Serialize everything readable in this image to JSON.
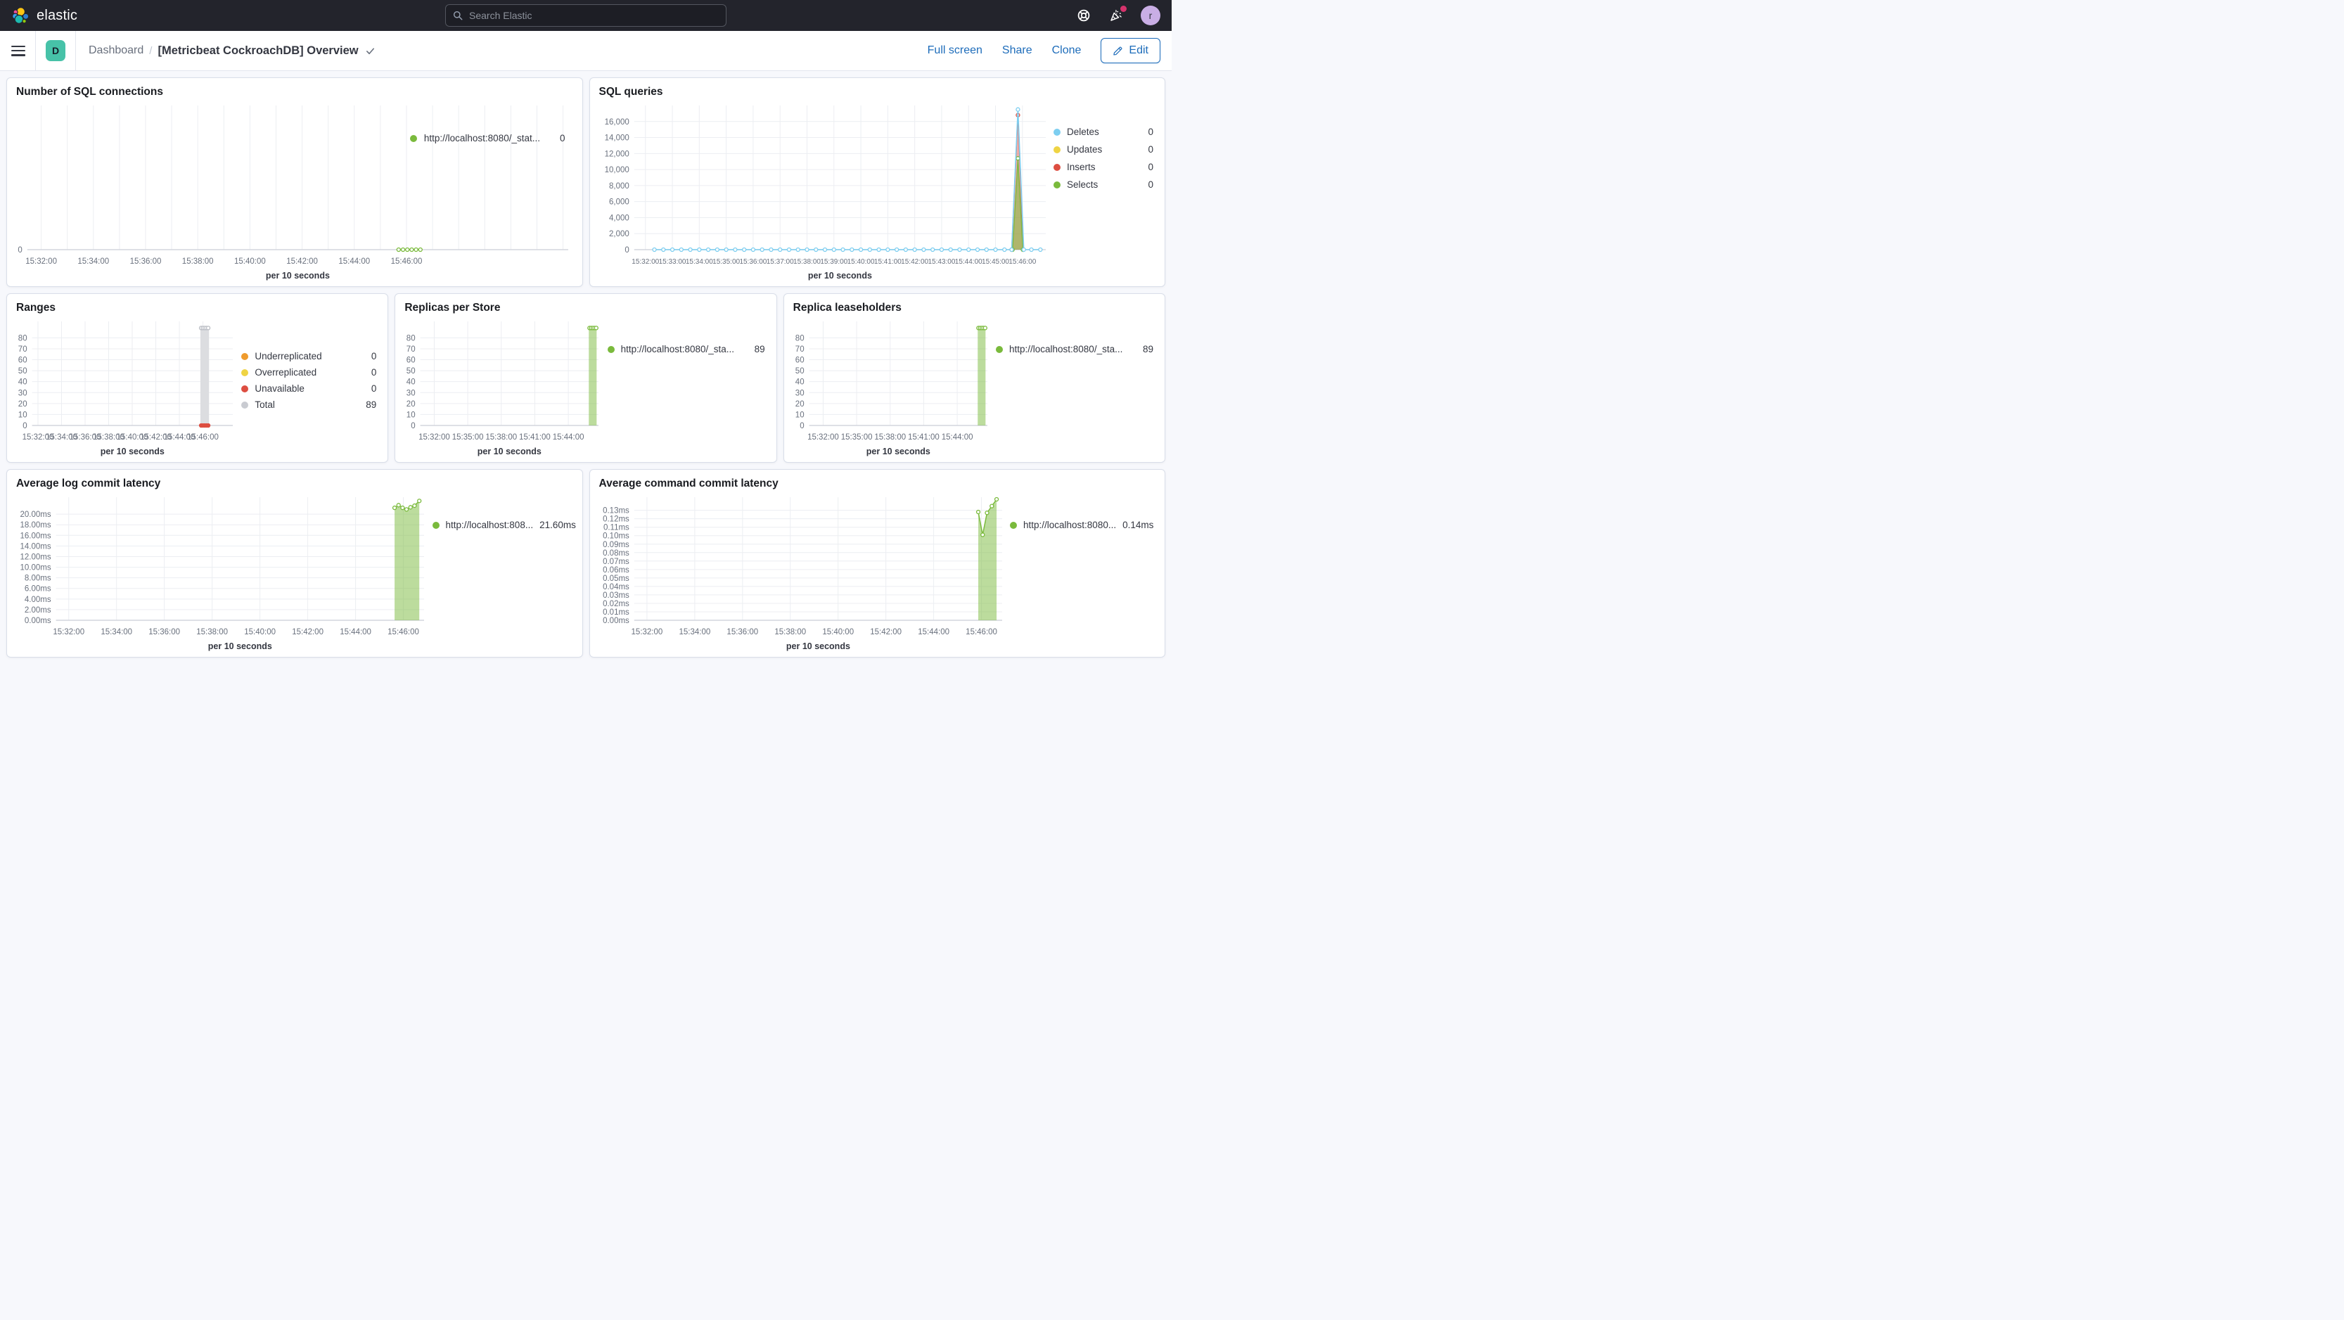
{
  "header": {
    "logo_text": "elastic",
    "search_placeholder": "Search Elastic",
    "help_icon": "help-lifering-icon",
    "news_icon": "party-popper-icon",
    "avatar_letter": "r",
    "colors": {
      "bar_bg": "#23242c",
      "notif_dot": "#d6336c",
      "avatar_bg": "#c9aee5"
    }
  },
  "nav": {
    "menu_icon": "hamburger-icon",
    "space_badge": "D",
    "breadcrumb_root": "Dashboard",
    "separator": "/",
    "title": "[Metricbeat CockroachDB] Overview",
    "title_check_icon": "check-icon",
    "actions": {
      "full_screen": "Full screen",
      "share": "Share",
      "clone": "Clone",
      "edit": "Edit"
    },
    "accent": "#1d6cba",
    "badge_color": "#47c2a8"
  },
  "series_colors": {
    "green": "#7aba3c",
    "blue": "#7dcef0",
    "yellow": "#efd444",
    "red": "#dd4e41",
    "orange": "#ef9b2d",
    "gray": "#c9cbd1"
  },
  "panels": [
    {
      "title": "Number of SQL connections",
      "xlabel": "per 10 seconds",
      "legend": [
        {
          "label": "http://localhost:8080/_stat...",
          "value": "0",
          "color": "#7aba3c"
        }
      ],
      "chart": {
        "x_domain": [
          88,
          1332
        ],
        "grid": [
          120,
          1320,
          60
        ],
        "x_ticks": [
          [
            120,
            "15:32:00"
          ],
          [
            240,
            "15:34:00"
          ],
          [
            360,
            "15:36:00"
          ],
          [
            480,
            "15:38:00"
          ],
          [
            600,
            "15:40:00"
          ],
          [
            720,
            "15:42:00"
          ],
          [
            840,
            "15:44:00"
          ],
          [
            960,
            "15:46:00"
          ]
        ],
        "y": {
          "min": 0,
          "scale_max": 1,
          "ticks": [
            0
          ],
          "labels": [
            "0"
          ]
        },
        "series": [
          {
            "name": "connections",
            "type": "line",
            "color": "#7aba3c",
            "width": 1.4,
            "markers": "hollow",
            "points": [
              [
                942,
                0
              ],
              [
                952,
                0
              ],
              [
                962,
                0
              ],
              [
                972,
                0
              ],
              [
                982,
                0
              ],
              [
                992,
                0
              ]
            ]
          }
        ]
      }
    },
    {
      "title": "SQL queries",
      "xlabel": "per 10 seconds",
      "legend": [
        {
          "label": "Deletes",
          "value": "0",
          "color": "#7dcef0"
        },
        {
          "label": "Updates",
          "value": "0",
          "color": "#efd444"
        },
        {
          "label": "Inserts",
          "value": "0",
          "color": "#dd4e41"
        },
        {
          "label": "Selects",
          "value": "0",
          "color": "#7aba3c"
        }
      ],
      "chart": {
        "tick_font": 10,
        "x_domain": [
          95,
          1012
        ],
        "grid": [
          120,
          960,
          60
        ],
        "x_ticks": [
          [
            120,
            "15:32:00"
          ],
          [
            180,
            "15:33:00"
          ],
          [
            240,
            "15:34:00"
          ],
          [
            300,
            "15:35:00"
          ],
          [
            360,
            "15:36:00"
          ],
          [
            420,
            "15:37:00"
          ],
          [
            480,
            "15:38:00"
          ],
          [
            540,
            "15:39:00"
          ],
          [
            600,
            "15:40:00"
          ],
          [
            660,
            "15:41:00"
          ],
          [
            720,
            "15:42:00"
          ],
          [
            780,
            "15:43:00"
          ],
          [
            840,
            "15:44:00"
          ],
          [
            900,
            "15:45:00"
          ],
          [
            960,
            "15:46:00"
          ]
        ],
        "y": {
          "min": 0,
          "scale_max": 18000,
          "ticks": [
            0,
            2000,
            4000,
            6000,
            8000,
            10000,
            12000,
            14000,
            16000
          ],
          "labels": [
            "0",
            "2,000",
            "4,000",
            "6,000",
            "8,000",
            "10,000",
            "12,000",
            "14,000",
            "16,000"
          ]
        },
        "series": [
          {
            "name": "Inserts",
            "type": "area",
            "color": "#dd4e41",
            "fill": "rgba(221,78,65,0.45)",
            "width": 1.3,
            "markers": "hollow",
            "points": [
              [
                936,
                0
              ],
              [
                950,
                16800
              ],
              [
                962,
                0
              ]
            ]
          },
          {
            "name": "Selects",
            "type": "area",
            "color": "#7aba3c",
            "fill": "rgba(122,186,60,0.55)",
            "width": 1.3,
            "markers": "hollow",
            "points": [
              [
                938,
                0
              ],
              [
                950,
                11400
              ],
              [
                961,
                0
              ]
            ]
          },
          {
            "name": "Deletes",
            "type": "line",
            "color": "#7dcef0",
            "width": 1.6,
            "markers": "hollow",
            "flat": [
              140,
              920,
              20,
              0
            ],
            "points": [
              [
                936,
                0
              ],
              [
                950,
                17500
              ],
              [
                963,
                0
              ],
              [
                980,
                0
              ],
              [
                1000,
                0
              ]
            ]
          }
        ]
      }
    },
    {
      "title": "Ranges",
      "xlabel": "per 10 seconds",
      "legend": [
        {
          "label": "Underreplicated",
          "value": "0",
          "color": "#ef9b2d"
        },
        {
          "label": "Overreplicated",
          "value": "0",
          "color": "#efd444"
        },
        {
          "label": "Unavailable",
          "value": "0",
          "color": "#dd4e41"
        },
        {
          "label": "Total",
          "value": "89",
          "color": "#c9cbd1"
        }
      ],
      "chart": {
        "x_domain": [
          90,
          1112
        ],
        "grid": [
          120,
          960,
          120
        ],
        "x_ticks": [
          [
            120,
            "15:32:00"
          ],
          [
            240,
            "15:34:00"
          ],
          [
            360,
            "15:36:00"
          ],
          [
            480,
            "15:38:00"
          ],
          [
            600,
            "15:40:00"
          ],
          [
            720,
            "15:42:00"
          ],
          [
            840,
            "15:44:00"
          ],
          [
            960,
            "15:46:00"
          ]
        ],
        "y": {
          "min": 0,
          "scale_max": 95,
          "ticks": [
            0,
            10,
            20,
            30,
            40,
            50,
            60,
            70,
            80
          ],
          "labels": [
            "0",
            "10",
            "20",
            "30",
            "40",
            "50",
            "60",
            "70",
            "80"
          ]
        },
        "series": [
          {
            "name": "Total",
            "type": "bar",
            "color": "#dcdde0",
            "bars": [
              [
                947,
                991,
                89
              ]
            ]
          },
          {
            "type": "markers",
            "style": "hollow",
            "color": "#b9bcc3",
            "points": [
              [
                951,
                89
              ],
              [
                960,
                89
              ],
              [
                969,
                89
              ],
              [
                978,
                89
              ],
              [
                987,
                89
              ]
            ]
          },
          {
            "name": "Unavailable",
            "type": "markers",
            "style": "solid",
            "color": "#dd4e41",
            "points": [
              [
                951,
                0
              ],
              [
                960,
                0
              ],
              [
                969,
                0
              ],
              [
                978,
                0
              ],
              [
                987,
                0
              ]
            ]
          }
        ]
      }
    },
    {
      "title": "Replicas per Store",
      "xlabel": "per 10 seconds",
      "legend": [
        {
          "label": "http://localhost:8080/_sta...",
          "value": "89",
          "color": "#7aba3c"
        }
      ],
      "chart": {
        "x_domain": [
          45,
          1002
        ],
        "grid": [
          120,
          960,
          180
        ],
        "x_ticks": [
          [
            120,
            "15:32:00"
          ],
          [
            300,
            "15:35:00"
          ],
          [
            480,
            "15:38:00"
          ],
          [
            660,
            "15:41:00"
          ],
          [
            840,
            "15:44:00"
          ]
        ],
        "y": {
          "min": 0,
          "scale_max": 95,
          "ticks": [
            0,
            10,
            20,
            30,
            40,
            50,
            60,
            70,
            80
          ],
          "labels": [
            "0",
            "10",
            "20",
            "30",
            "40",
            "50",
            "60",
            "70",
            "80"
          ]
        },
        "series": [
          {
            "name": "replicas",
            "type": "bar",
            "color": "rgba(122,186,60,0.5)",
            "bars": [
              [
                950,
                992,
                89
              ]
            ]
          },
          {
            "type": "markers",
            "style": "hollow",
            "color": "#7aba3c",
            "points": [
              [
                954,
                89
              ],
              [
                963,
                89
              ],
              [
                972,
                89
              ],
              [
                981,
                89
              ],
              [
                990,
                89
              ]
            ]
          }
        ]
      }
    },
    {
      "title": "Replica leaseholders",
      "xlabel": "per 10 seconds",
      "legend": [
        {
          "label": "http://localhost:8080/_sta...",
          "value": "89",
          "color": "#7aba3c"
        }
      ],
      "chart": {
        "x_domain": [
          45,
          1002
        ],
        "grid": [
          120,
          960,
          180
        ],
        "x_ticks": [
          [
            120,
            "15:32:00"
          ],
          [
            300,
            "15:35:00"
          ],
          [
            480,
            "15:38:00"
          ],
          [
            660,
            "15:41:00"
          ],
          [
            840,
            "15:44:00"
          ]
        ],
        "y": {
          "min": 0,
          "scale_max": 95,
          "ticks": [
            0,
            10,
            20,
            30,
            40,
            50,
            60,
            70,
            80
          ],
          "labels": [
            "0",
            "10",
            "20",
            "30",
            "40",
            "50",
            "60",
            "70",
            "80"
          ]
        },
        "series": [
          {
            "name": "leaseholders",
            "type": "bar",
            "color": "rgba(122,186,60,0.5)",
            "bars": [
              [
                950,
                992,
                89
              ]
            ]
          },
          {
            "type": "markers",
            "style": "hollow",
            "color": "#7aba3c",
            "points": [
              [
                954,
                89
              ],
              [
                963,
                89
              ],
              [
                972,
                89
              ],
              [
                981,
                89
              ],
              [
                990,
                89
              ]
            ]
          }
        ]
      }
    },
    {
      "title": "Average log commit latency",
      "xlabel": "per 10 seconds",
      "legend": [
        {
          "label": "http://localhost:808...",
          "value": "21.60ms",
          "color": "#7aba3c"
        }
      ],
      "chart": {
        "x_domain": [
          88,
          1012
        ],
        "grid": [
          120,
          960,
          120
        ],
        "x_ticks": [
          [
            120,
            "15:32:00"
          ],
          [
            240,
            "15:34:00"
          ],
          [
            360,
            "15:36:00"
          ],
          [
            480,
            "15:38:00"
          ],
          [
            600,
            "15:40:00"
          ],
          [
            720,
            "15:42:00"
          ],
          [
            840,
            "15:44:00"
          ],
          [
            960,
            "15:46:00"
          ]
        ],
        "y": {
          "min": 0,
          "scale_max": 23.2,
          "ticks": [
            0,
            2,
            4,
            6,
            8,
            10,
            12,
            14,
            16,
            18,
            20
          ],
          "labels": [
            "0.00ms",
            "2.00ms",
            "4.00ms",
            "6.00ms",
            "8.00ms",
            "10.00ms",
            "12.00ms",
            "14.00ms",
            "16.00ms",
            "18.00ms",
            "20.00ms"
          ]
        },
        "series": [
          {
            "name": "log latency",
            "type": "area",
            "color": "#7aba3c",
            "fill": "rgba(122,186,60,0.5)",
            "width": 1.5,
            "markers": "hollow",
            "points": [
              [
                938,
                21.2
              ],
              [
                948,
                21.7
              ],
              [
                958,
                21.2
              ],
              [
                968,
                20.9
              ],
              [
                978,
                21.3
              ],
              [
                988,
                21.6
              ],
              [
                1000,
                22.5
              ]
            ]
          }
        ]
      }
    },
    {
      "title": "Average command commit latency",
      "xlabel": "per 10 seconds",
      "legend": [
        {
          "label": "http://localhost:8080...",
          "value": "0.14ms",
          "color": "#7aba3c"
        }
      ],
      "chart": {
        "x_domain": [
          88,
          1012
        ],
        "grid": [
          120,
          960,
          120
        ],
        "x_ticks": [
          [
            120,
            "15:32:00"
          ],
          [
            240,
            "15:34:00"
          ],
          [
            360,
            "15:36:00"
          ],
          [
            480,
            "15:38:00"
          ],
          [
            600,
            "15:40:00"
          ],
          [
            720,
            "15:42:00"
          ],
          [
            840,
            "15:44:00"
          ],
          [
            960,
            "15:46:00"
          ]
        ],
        "y": {
          "min": 0,
          "scale_max": 0.1455,
          "ticks": [
            0,
            0.01,
            0.02,
            0.03,
            0.04,
            0.05,
            0.06,
            0.07,
            0.08,
            0.09,
            0.1,
            0.11,
            0.12,
            0.13
          ],
          "labels": [
            "0.00ms",
            "0.01ms",
            "0.02ms",
            "0.03ms",
            "0.04ms",
            "0.05ms",
            "0.06ms",
            "0.07ms",
            "0.08ms",
            "0.09ms",
            "0.10ms",
            "0.11ms",
            "0.12ms",
            "0.13ms"
          ]
        },
        "series": [
          {
            "name": "command latency",
            "type": "area",
            "color": "#7aba3c",
            "fill": "rgba(122,186,60,0.5)",
            "width": 1.5,
            "markers": "hollow",
            "points": [
              [
                952,
                0.128
              ],
              [
                963,
                0.101
              ],
              [
                974,
                0.127
              ],
              [
                986,
                0.135
              ],
              [
                998,
                0.143
              ]
            ]
          }
        ]
      }
    }
  ]
}
